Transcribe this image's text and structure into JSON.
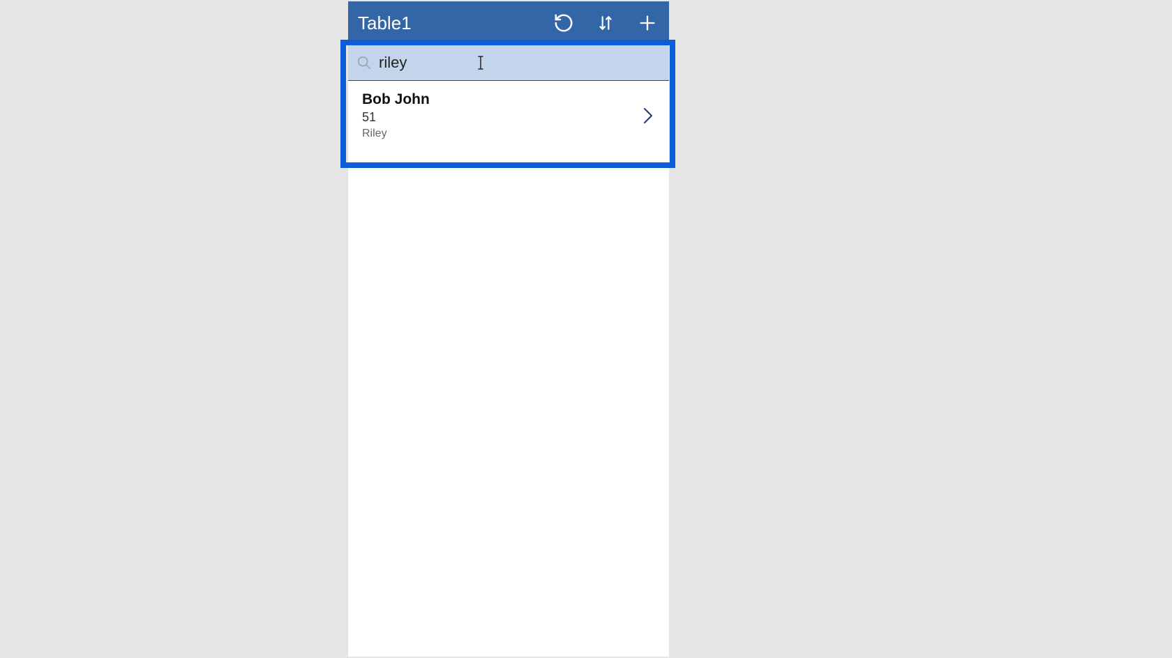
{
  "header": {
    "title": "Table1"
  },
  "search": {
    "value": "riley"
  },
  "results": [
    {
      "name": "Bob John",
      "sub1": "51",
      "sub2": "Riley"
    }
  ]
}
